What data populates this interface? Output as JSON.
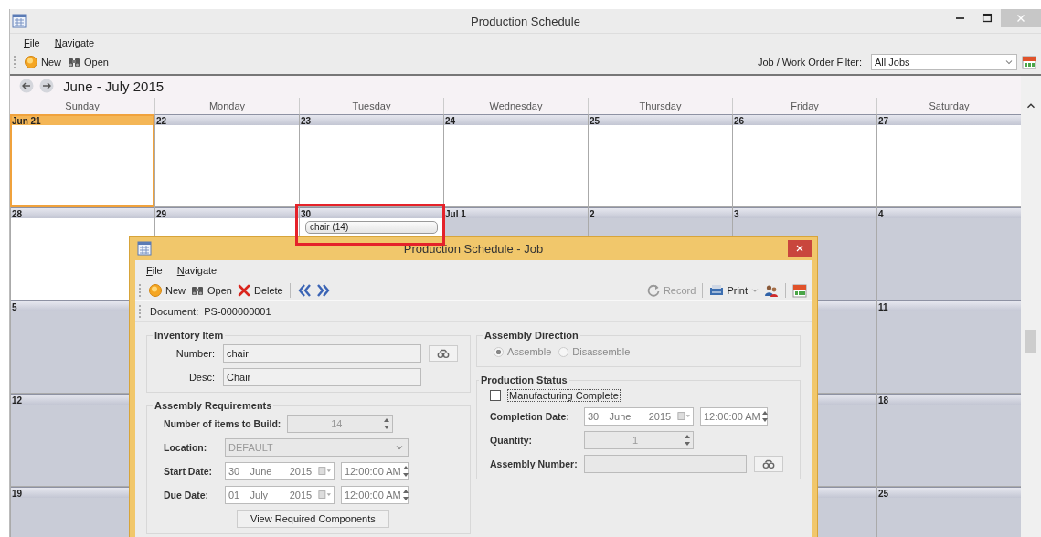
{
  "window": {
    "title": "Production Schedule"
  },
  "menu": [
    {
      "label": "File"
    },
    {
      "label": "Navigate"
    }
  ],
  "toolbar": [
    {
      "kind": "new",
      "label": "New"
    },
    {
      "kind": "open",
      "label": "Open"
    }
  ],
  "filter": {
    "label": "Job / Work Order Filter:",
    "value": "All Jobs"
  },
  "calendar": {
    "title": "June - July 2015",
    "weekdays": [
      "Sunday",
      "Monday",
      "Tuesday",
      "Wednesday",
      "Thursday",
      "Friday",
      "Saturday"
    ],
    "weeks": [
      {
        "days": [
          {
            "label": "Jun 21",
            "selected": true,
            "shaded": false
          },
          {
            "label": "22",
            "selected": false,
            "shaded": false
          },
          {
            "label": "23",
            "selected": false,
            "shaded": false
          },
          {
            "label": "24",
            "selected": false,
            "shaded": false
          },
          {
            "label": "25",
            "selected": false,
            "shaded": false
          },
          {
            "label": "26",
            "selected": false,
            "shaded": false
          },
          {
            "label": "27",
            "selected": false,
            "shaded": false
          }
        ]
      },
      {
        "days": [
          {
            "label": "28",
            "selected": false,
            "shaded": false
          },
          {
            "label": "29",
            "selected": false,
            "shaded": false
          },
          {
            "label": "30",
            "selected": false,
            "shaded": false,
            "highlighted": true,
            "events": [
              "chair (14)"
            ]
          },
          {
            "label": "Jul 1",
            "selected": false,
            "shaded": true
          },
          {
            "label": "2",
            "selected": false,
            "shaded": true
          },
          {
            "label": "3",
            "selected": false,
            "shaded": true
          },
          {
            "label": "4",
            "selected": false,
            "shaded": true
          }
        ]
      },
      {
        "days": [
          {
            "label": "5",
            "selected": false,
            "shaded": true
          },
          {
            "selected": false,
            "shaded": true
          },
          {
            "label": "11",
            "selected": false,
            "shaded": true
          }
        ]
      },
      {
        "days": [
          {
            "label": "12",
            "selected": false,
            "shaded": true
          },
          {
            "selected": false,
            "shaded": true
          },
          {
            "label": "18",
            "selected": false,
            "shaded": true
          }
        ]
      },
      {
        "days": [
          {
            "label": "19",
            "selected": false,
            "shaded": true
          },
          {
            "selected": false,
            "shaded": true
          },
          {
            "label": "25",
            "selected": false,
            "shaded": true
          }
        ]
      }
    ]
  },
  "dialog": {
    "title": "Production Schedule - Job",
    "menu": [
      {
        "label": "File"
      },
      {
        "label": "Navigate"
      }
    ],
    "toolbar_left": [
      {
        "kind": "new",
        "label": "New"
      },
      {
        "kind": "open",
        "label": "Open"
      },
      {
        "kind": "delete",
        "label": "Delete"
      },
      {
        "kind": "separator"
      },
      {
        "kind": "back"
      },
      {
        "kind": "forward"
      }
    ],
    "toolbar_right": [
      {
        "kind": "record",
        "label": "Record",
        "disabled": true
      },
      {
        "kind": "separator"
      },
      {
        "kind": "print",
        "label": "Print",
        "dropdown": true
      },
      {
        "kind": "users"
      },
      {
        "kind": "separator"
      },
      {
        "kind": "calendar"
      }
    ],
    "document": {
      "label": "Document:",
      "value": "PS-000000001"
    },
    "inventory_item": {
      "title": "Inventory Item",
      "number_label": "Number:",
      "number": "chair",
      "desc_label": "Desc:",
      "desc": "Chair"
    },
    "assembly_requirements": {
      "title": "Assembly Requirements",
      "items_label": "Number of items to Build:",
      "items": "14",
      "location_label": "Location:",
      "location": "DEFAULT",
      "start_label": "Start Date:",
      "start": {
        "day": "30",
        "month": "June",
        "year": "2015",
        "time": "12:00:00 AM"
      },
      "due_label": "Due Date:",
      "due": {
        "day": "01",
        "month": "July",
        "year": "2015",
        "time": "12:00:00 AM"
      },
      "button": "View Required Components"
    },
    "assembly_direction": {
      "title": "Assembly Direction",
      "options": [
        {
          "label": "Assemble",
          "selected": true
        },
        {
          "label": "Disassemble",
          "selected": false
        }
      ]
    },
    "production_status": {
      "title": "Production Status",
      "complete": {
        "label": "Manufacturing Complete",
        "checked": false
      },
      "completion_label": "Completion Date:",
      "completion": {
        "day": "30",
        "month": "June",
        "year": "2015",
        "time": "12:00:00 AM"
      },
      "quantity_label": "Quantity:",
      "quantity": "1",
      "assembly_number_label": "Assembly Number:"
    }
  }
}
